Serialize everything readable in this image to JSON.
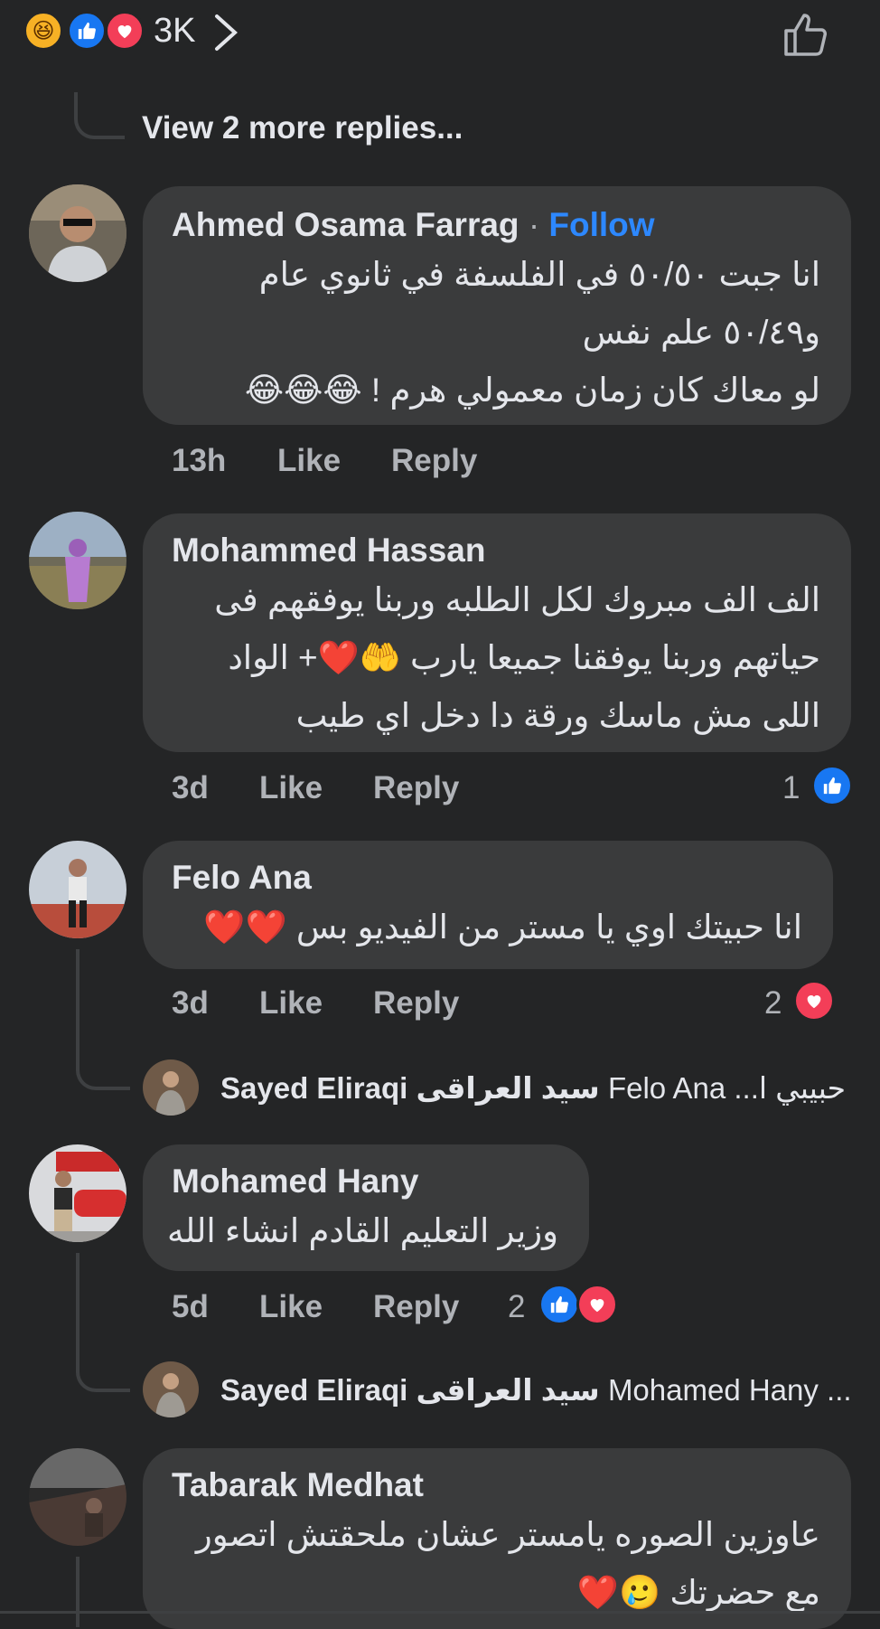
{
  "top_reactions": {
    "icons": [
      "haha-icon",
      "like-icon",
      "love-icon"
    ],
    "count": "3K",
    "chevron": "›"
  },
  "view_more": "View 2 more replies...",
  "comments": [
    {
      "author": "Ahmed Osama Farrag",
      "follow_sep": "·",
      "follow": "Follow",
      "lines": [
        "انا جبت ٥٠/٥٠ في الفلسفة في ثانوي عام",
        "و٥٠/٤٩ علم نفس",
        "لو معاك كان زمان معمولي هرم ! 😂😂😂"
      ],
      "time": "13h",
      "like": "Like",
      "reply": "Reply"
    },
    {
      "author": "Mohammed Hassan",
      "lines": [
        "الف الف مبروك لكل الطلبه وربنا يوفقهم فى",
        "حياتهم وربنا يوفقنا جميعا يارب 🤲❤️+ الواد",
        "اللى مش ماسك ورقة دا دخل اي طيب"
      ],
      "time": "3d",
      "like": "Like",
      "reply": "Reply",
      "reaction_count": "1"
    },
    {
      "author": "Felo Ana",
      "lines": [
        "انا حبيتك اوي يا مستر من الفيديو بس ❤️❤️"
      ],
      "time": "3d",
      "like": "Like",
      "reply": "Reply",
      "reaction_count": "2",
      "reply_preview": {
        "name": "Sayed Eliraqi سيد العراقى",
        "text": "Felo Ana ...حبيبي ا"
      }
    },
    {
      "author": "Mohamed Hany",
      "lines": [
        "وزير التعليم القادم انشاء الله"
      ],
      "time": "5d",
      "like": "Like",
      "reply": "Reply",
      "reaction_count": "2",
      "reply_preview": {
        "name": "Sayed Eliraqi سيد العراقى",
        "text": "Mohamed Hany ..."
      }
    },
    {
      "author": "Tabarak Medhat",
      "lines": [
        "عاوزين الصوره يامستر عشان ملحقتش اتصور",
        "مع حضرتك 🥲❤️"
      ]
    }
  ],
  "colors": {
    "background": "#242526",
    "bubble": "#3a3b3c",
    "text": "#e4e6eb",
    "secondary": "#b0b3b8",
    "link": "#2d88ff",
    "like_blue": "#1877f2",
    "love_red": "#f33e58"
  }
}
